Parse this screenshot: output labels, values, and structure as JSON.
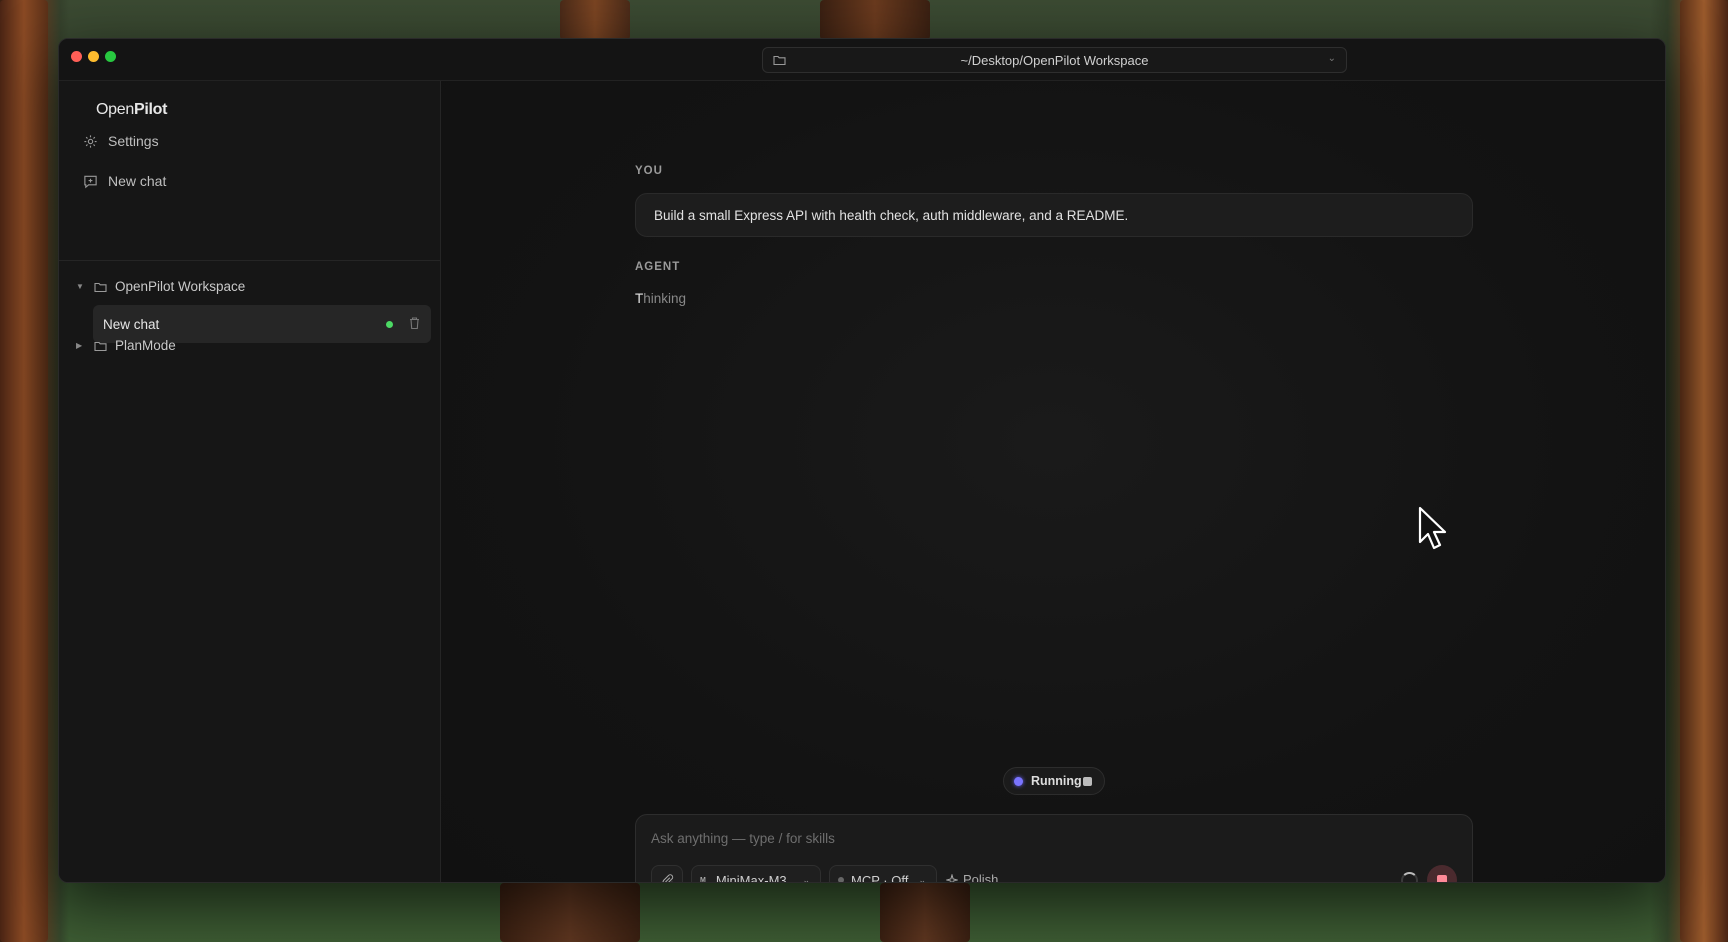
{
  "window": {
    "path": "~/Desktop/OpenPilot Workspace"
  },
  "sidebar": {
    "brand_light": "Open",
    "brand_bold": "Pilot",
    "settings_label": "Settings",
    "new_chat_label": "New chat",
    "folders": [
      {
        "name": "OpenPilot Workspace",
        "expanded": true,
        "chats": [
          {
            "title": "New chat",
            "status": "active"
          }
        ]
      },
      {
        "name": "PlanMode",
        "expanded": false
      }
    ]
  },
  "conversation": {
    "you_label": "YOU",
    "user_message": "Build a small Express API with health check, auth middleware, and a README.",
    "agent_label": "AGENT",
    "agent_status_first": "T",
    "agent_status_rest": "hinking"
  },
  "run": {
    "status_label": "Running"
  },
  "composer": {
    "placeholder": "Ask anything — type / for skills",
    "model_label": "MiniMax-M3",
    "model_logo": "M",
    "mcp_label": "MCP · Off",
    "polish_label": "Polish"
  },
  "colors": {
    "running_dot": "#7a74ff",
    "active_dot": "#4cd964",
    "stop_button": "#ff8a98"
  }
}
